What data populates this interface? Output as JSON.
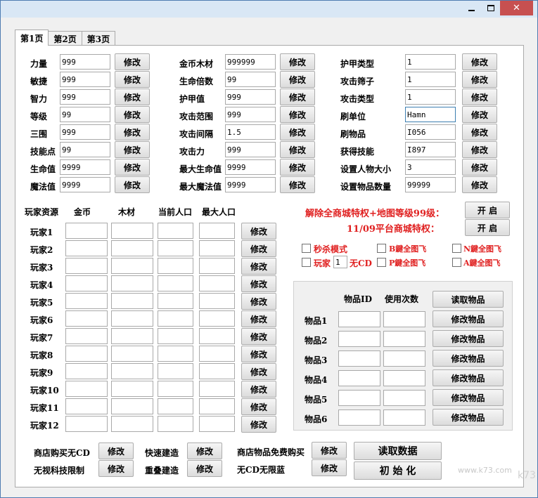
{
  "window": {
    "min": "—",
    "max": "□",
    "close": "✕"
  },
  "tabs": [
    "第1页",
    "第2页",
    "第3页"
  ],
  "stats": {
    "col1": [
      {
        "label": "力量",
        "value": "999"
      },
      {
        "label": "敏捷",
        "value": "999"
      },
      {
        "label": "智力",
        "value": "999"
      },
      {
        "label": "等级",
        "value": "99"
      },
      {
        "label": "三围",
        "value": "999"
      },
      {
        "label": "技能点",
        "value": "99"
      },
      {
        "label": "生命值",
        "value": "9999"
      },
      {
        "label": "魔法值",
        "value": "9999"
      }
    ],
    "col2": [
      {
        "label": "金币木材",
        "value": "999999"
      },
      {
        "label": "生命倍数",
        "value": "99"
      },
      {
        "label": "护甲值",
        "value": "999"
      },
      {
        "label": "攻击范围",
        "value": "999"
      },
      {
        "label": "攻击间隔",
        "value": "1.5"
      },
      {
        "label": "攻击力",
        "value": "999"
      },
      {
        "label": "最大生命值",
        "value": "9999"
      },
      {
        "label": "最大魔法值",
        "value": "9999"
      }
    ],
    "col3": [
      {
        "label": "护甲类型",
        "value": "1"
      },
      {
        "label": "攻击筛子",
        "value": "1"
      },
      {
        "label": "攻击类型",
        "value": "1"
      },
      {
        "label": "刷单位",
        "value": "Hamn"
      },
      {
        "label": "刷物品",
        "value": "I056"
      },
      {
        "label": "获得技能",
        "value": "I897"
      },
      {
        "label": "设置人物大小",
        "value": "3"
      },
      {
        "label": "设置物品数量",
        "value": "99999"
      }
    ],
    "modify_label": "修改"
  },
  "players": {
    "headers": [
      "玩家资源",
      "金币",
      "木材",
      "当前人口",
      "最大人口"
    ],
    "rows": [
      "玩家1",
      "玩家2",
      "玩家3",
      "玩家4",
      "玩家5",
      "玩家6",
      "玩家7",
      "玩家8",
      "玩家9",
      "玩家10",
      "玩家11",
      "玩家12"
    ],
    "modify_label": "修改"
  },
  "privileges": {
    "line1": "解除全商城特权+地图等级99级：",
    "line2": "11/09平台商城特权：",
    "button": "开 启"
  },
  "options": {
    "one_hit_kill": "秒杀模式",
    "player_label": "玩家",
    "player_value": "1",
    "no_cd": "无CD",
    "b_fly": "B鍵全图飞",
    "p_fly": "P鍵全图飞",
    "n_fly": "N鍵全图飞",
    "a_fly": "A鍵全图飞"
  },
  "items": {
    "headers": [
      "物品ID",
      "使用次数"
    ],
    "read_button": "读取物品",
    "rows": [
      "物品1",
      "物品2",
      "物品3",
      "物品4",
      "物品5",
      "物品6"
    ],
    "modify_button": "修改物品"
  },
  "bottom": {
    "shop_free_cd": "商店购买无CD",
    "ignore_tech": "无视科技限制",
    "fast_build": "快速建造",
    "overlap_build": "重叠建造",
    "shop_free_buy": "商店物品免费购买",
    "no_cd_mana": "无CD无限蓝",
    "modify": "修改",
    "read_data": "读取数据",
    "init": "初 始 化"
  },
  "watermark": "www.k73.com",
  "watermark2": "k73"
}
